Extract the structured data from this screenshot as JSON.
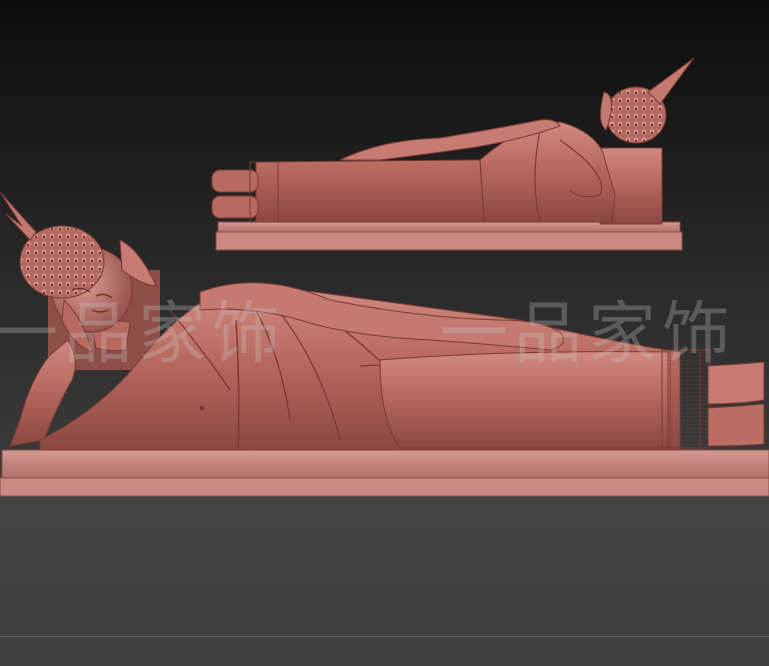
{
  "scene": {
    "description_type": "3d-relief-render",
    "watermark_text": "一品家饰",
    "colors": {
      "model": "#b86a60",
      "model_dark": "#7a3a33",
      "model_light": "#d8938a",
      "base": "#c4847c",
      "background_top": "#0c0c0c",
      "background_bottom": "#444444"
    }
  }
}
